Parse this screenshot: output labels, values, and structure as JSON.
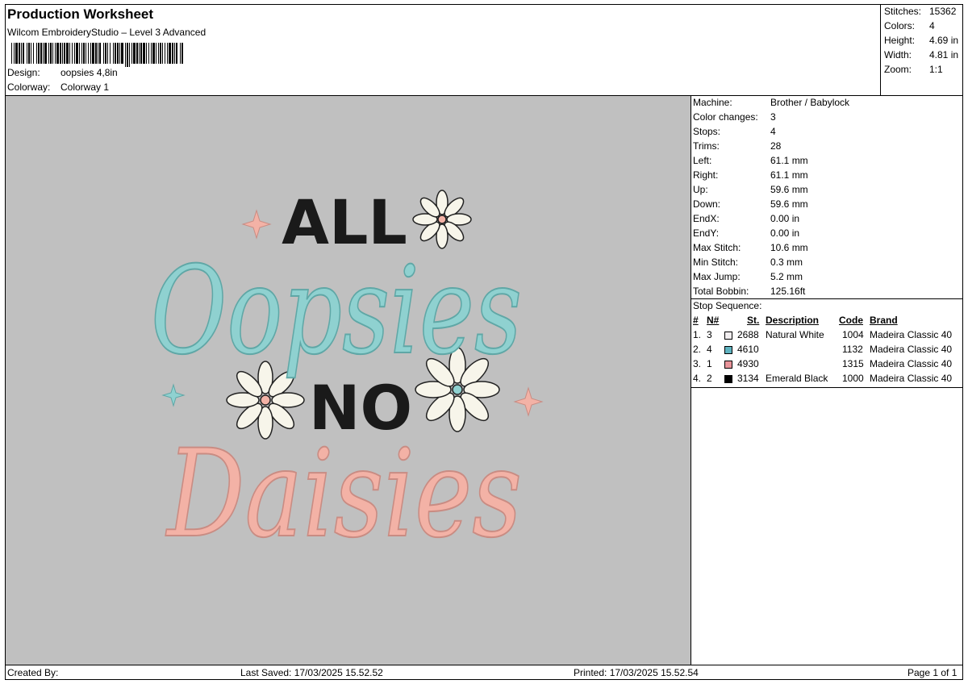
{
  "header": {
    "title": "Production Worksheet",
    "software": "Wilcom EmbroideryStudio – Level 3 Advanced",
    "design_label": "Design:",
    "design_value": "oopsies 4,8in",
    "colorway_label": "Colorway:",
    "colorway_value": "Colorway 1"
  },
  "stats": [
    {
      "label": "Stitches:",
      "value": "15362"
    },
    {
      "label": "Colors:",
      "value": "4"
    },
    {
      "label": "Height:",
      "value": "4.69 in"
    },
    {
      "label": "Width:",
      "value": "4.81 in"
    },
    {
      "label": "Zoom:",
      "value": "1:1"
    }
  ],
  "design_text": {
    "line1": "ALL",
    "line2": "Oopsies",
    "line3": "NO",
    "line4": "Daisies"
  },
  "colors": {
    "aqua": "#8fd1d0",
    "pink": "#f3b2a6",
    "black": "#1a1a1a",
    "white": "#f7f5ea",
    "canvas": "#c0c0c0"
  },
  "machine_info": [
    {
      "label": "Machine:",
      "value": "Brother / Babylock"
    },
    {
      "label": "Color changes:",
      "value": "3"
    },
    {
      "label": "Stops:",
      "value": "4"
    },
    {
      "label": "Trims:",
      "value": "28"
    },
    {
      "label": "Left:",
      "value": "61.1 mm"
    },
    {
      "label": "Right:",
      "value": "61.1 mm"
    },
    {
      "label": "Up:",
      "value": "59.6 mm"
    },
    {
      "label": "Down:",
      "value": "59.6 mm"
    },
    {
      "label": "EndX:",
      "value": "0.00 in"
    },
    {
      "label": "EndY:",
      "value": "0.00 in"
    },
    {
      "label": "Max Stitch:",
      "value": "10.6 mm"
    },
    {
      "label": "Min Stitch:",
      "value": "0.3 mm"
    },
    {
      "label": "Max Jump:",
      "value": "5.2 mm"
    },
    {
      "label": "Total Bobbin:",
      "value": "125.16ft"
    }
  ],
  "stop_sequence": {
    "title": "Stop Sequence:",
    "headers": {
      "num": "#",
      "n": "N#",
      "st": "St.",
      "description": "Description",
      "code": "Code",
      "brand": "Brand"
    },
    "rows": [
      {
        "num": "1.",
        "n": "3",
        "swatch": "#f2eef0",
        "st": "2688",
        "description": "Natural White",
        "code": "1004",
        "brand": "Madeira Classic 40"
      },
      {
        "num": "2.",
        "n": "4",
        "swatch": "#5fb3c0",
        "st": "4610",
        "description": "",
        "code": "1132",
        "brand": "Madeira Classic 40"
      },
      {
        "num": "3.",
        "n": "1",
        "swatch": "#e8949a",
        "st": "4930",
        "description": "",
        "code": "1315",
        "brand": "Madeira Classic 40"
      },
      {
        "num": "4.",
        "n": "2",
        "swatch": "#000000",
        "st": "3134",
        "description": "Emerald Black",
        "code": "1000",
        "brand": "Madeira Classic 40"
      }
    ]
  },
  "footer": {
    "created_by": "Created By:",
    "last_saved": "Last Saved: 17/03/2025 15.52.52",
    "printed": "Printed: 17/03/2025 15.52.54",
    "page": "Page 1 of 1"
  }
}
